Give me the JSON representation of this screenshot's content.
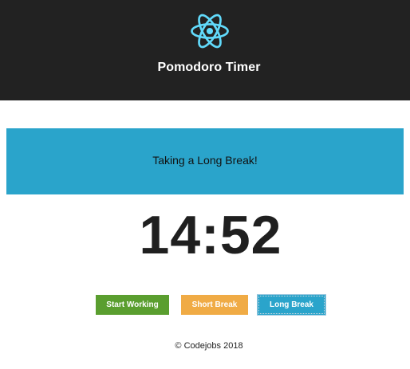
{
  "header": {
    "title": "Pomodoro Timer",
    "logo_icon": "react-atom-icon",
    "background_color": "#222222",
    "logo_color": "#61dafb"
  },
  "status": {
    "message": "Taking a Long Break!",
    "background_color": "#2aa4cb"
  },
  "timer": {
    "display": "14:52"
  },
  "buttons": {
    "start_working": {
      "label": "Start Working",
      "color": "#5a9e2f"
    },
    "short_break": {
      "label": "Short Break",
      "color": "#f0ab45"
    },
    "long_break": {
      "label": "Long Break",
      "color": "#2aa4cb"
    }
  },
  "footer": {
    "copyright": "© Codejobs 2018"
  }
}
